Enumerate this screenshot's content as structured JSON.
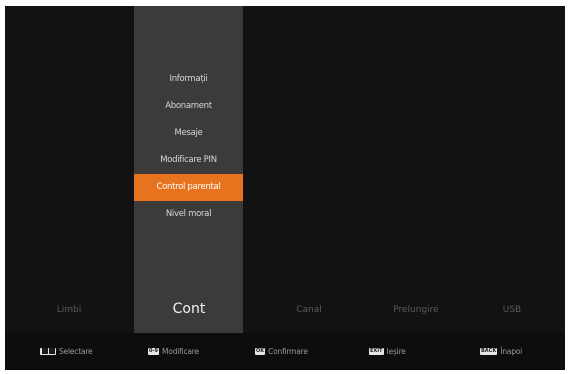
{
  "menu": {
    "items": [
      {
        "label": "Informații"
      },
      {
        "label": "Abonament"
      },
      {
        "label": "Mesaje"
      },
      {
        "label": "Modificare PIN"
      },
      {
        "label": "Control parental"
      },
      {
        "label": "Nivel moral"
      }
    ],
    "selected_index": 4
  },
  "categories": [
    {
      "label": "Limbi"
    },
    {
      "label": "Cont"
    },
    {
      "label": "Canal"
    },
    {
      "label": "Prelungire"
    },
    {
      "label": "USB"
    }
  ],
  "selected_category_index": 1,
  "footer": {
    "hints": [
      {
        "key": "◄►",
        "label": "Selectare"
      },
      {
        "key": "0-9",
        "label": "Modificare"
      },
      {
        "key": "OK",
        "label": "Confirmare"
      },
      {
        "key": "EXIT",
        "label": "Ieșire"
      },
      {
        "key": "BACK",
        "label": "Înapoi"
      }
    ]
  },
  "colors": {
    "background": "#121212",
    "panel": "#3c3b39",
    "accent": "#e8731f",
    "footer": "#0d0d0d"
  }
}
